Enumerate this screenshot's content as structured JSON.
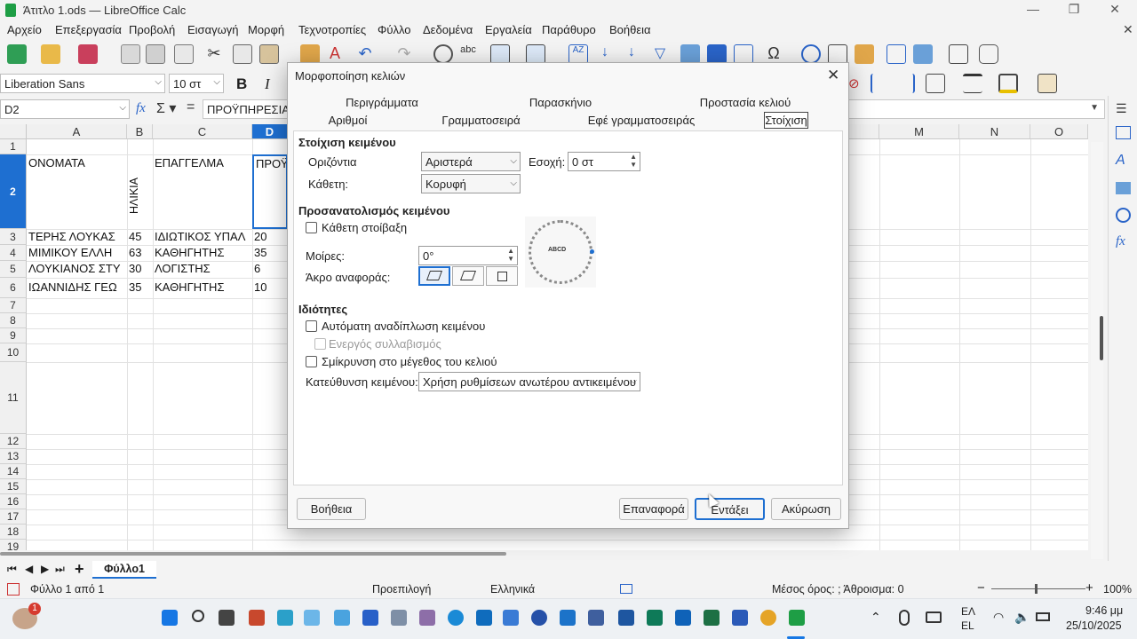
{
  "window": {
    "title": "Άτιτλο 1.ods — LibreOffice Calc"
  },
  "menu": [
    "Αρχείο",
    "Επεξεργασία",
    "Προβολή",
    "Εισαγωγή",
    "Μορφή",
    "Τεχνοτροπίες",
    "Φύλλο",
    "Δεδομένα",
    "Εργαλεία",
    "Παράθυρο",
    "Βοήθεια"
  ],
  "font": {
    "name": "Liberation Sans",
    "size": "10 στ"
  },
  "formula": {
    "cell_ref": "D2",
    "content": "ΠΡΟΫΠΗΡΕΣΙΑ"
  },
  "columns": [
    "A",
    "B",
    "C",
    "D",
    "M",
    "N",
    "O"
  ],
  "rows": [
    "1",
    "2",
    "3",
    "4",
    "5",
    "6",
    "7",
    "8",
    "9",
    "10",
    "11",
    "12",
    "13",
    "14",
    "15",
    "16",
    "17",
    "18",
    "19"
  ],
  "cells": {
    "a2": "ΟΝΟΜΑΤΑ",
    "b2": "ΗΛΙΚΙΑ",
    "c2": "ΕΠΑΓΓΕΛΜΑ",
    "d2": "ΠΡΟΫ",
    "a3": "ΤΕΡΗΣ ΛΟΥΚΑΣ",
    "b3": "45",
    "c3": "ΙΔΙΩΤΙΚΟΣ ΥΠΑΛ",
    "d3": "20",
    "a4": "ΜΙΜΙΚΟΥ ΕΛΛΗ",
    "b4": "63",
    "c4": "ΚΑΘΗΓΗΤΗΣ",
    "d4": "35",
    "a5": "ΛΟΥΚΙΑΝΟΣ ΣΤΥ",
    "b5": "30",
    "c5": "ΛΟΓΙΣΤΗΣ",
    "d5": "6",
    "a6": "ΙΩΑΝΝΙΔΗΣ ΓΕΩ",
    "b6": "35",
    "c6": "ΚΑΘΗΓΗΤΗΣ",
    "d6": "10"
  },
  "sheet_tab": "Φύλλο1",
  "status": {
    "sheet": "Φύλλο 1 από 1",
    "style": "Προεπιλογή",
    "language": "Ελληνικά",
    "sum": "Μέσος όρος: ; Άθροισμα: 0",
    "zoom": "100%"
  },
  "dialog": {
    "title": "Μορφοποίηση κελιών",
    "tabs_row1": [
      "Περιγράμματα",
      "Παρασκήνιο",
      "Προστασία κελιού"
    ],
    "tabs_row2": [
      "Αριθμοί",
      "Γραμματοσειρά",
      "Εφέ γραμματοσειράς",
      "Στοίχιση"
    ],
    "align_section": "Στοίχιση κειμένου",
    "horizontal_label": "Οριζόντια",
    "horizontal_value": "Αριστερά",
    "indent_label": "Εσοχή:",
    "indent_value": "0 στ",
    "vertical_label": "Κάθετη:",
    "vertical_value": "Κορυφή",
    "orient_section": "Προσανατολισμός κειμένου",
    "vertical_stack": "Κάθετη στοίβαξη",
    "degrees_label": "Μοίρες:",
    "degrees_value": "0°",
    "ref_edge_label": "Άκρο αναφοράς:",
    "dial_text": "ABCD",
    "props_section": "Ιδιότητες",
    "wrap": "Αυτόματη αναδίπλωση κειμένου",
    "hyphen": "Ενεργός συλλαβισμός",
    "shrink": "Σμίκρυνση στο μέγεθος του κελιού",
    "direction_label": "Κατεύθυνση κειμένου:",
    "direction_value": "Χρήση ρυθμίσεων ανωτέρου αντικειμένου",
    "help_btn": "Βοήθεια",
    "reset_btn": "Επαναφορά",
    "ok_btn": "Εντάξει",
    "cancel_btn": "Ακύρωση"
  },
  "tray": {
    "lang1": "ΕΛ",
    "lang2": "EL",
    "time": "9:46 μμ",
    "date": "25/10/2025",
    "badge": "1"
  },
  "colors": {
    "accent": "#0a64d4",
    "select": "#1e6fd1",
    "calc_green": "#1e9e45"
  }
}
